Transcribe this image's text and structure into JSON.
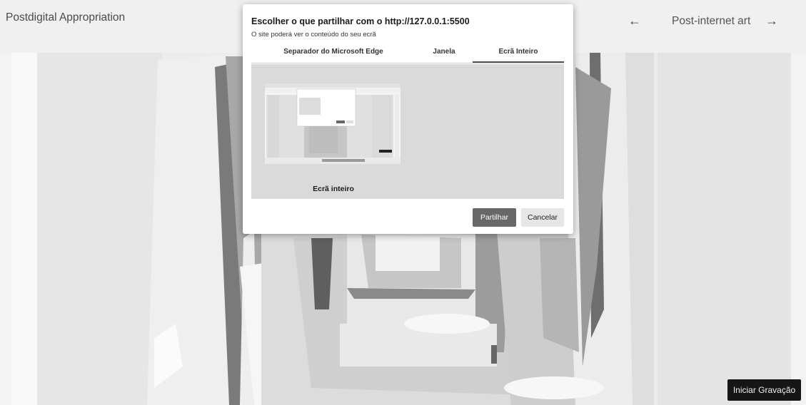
{
  "header": {
    "title": "Postdigital Appropriation",
    "prev_icon": "←",
    "next_icon": "→",
    "current_label": "Post-internet art"
  },
  "dialog": {
    "title": "Escolher o que partilhar com o http://127.0.0.1:5500",
    "subtitle": "O site poderá ver o conteúdo do seu ecrã",
    "tabs": [
      {
        "label": "Separador do Microsoft Edge"
      },
      {
        "label": "Janela"
      },
      {
        "label": "Ecrã Inteiro",
        "selected": true
      }
    ],
    "option_label": "Ecrã inteiro",
    "share_label": "Partilhar",
    "cancel_label": "Cancelar"
  },
  "record_button": "Iniciar Gravação"
}
